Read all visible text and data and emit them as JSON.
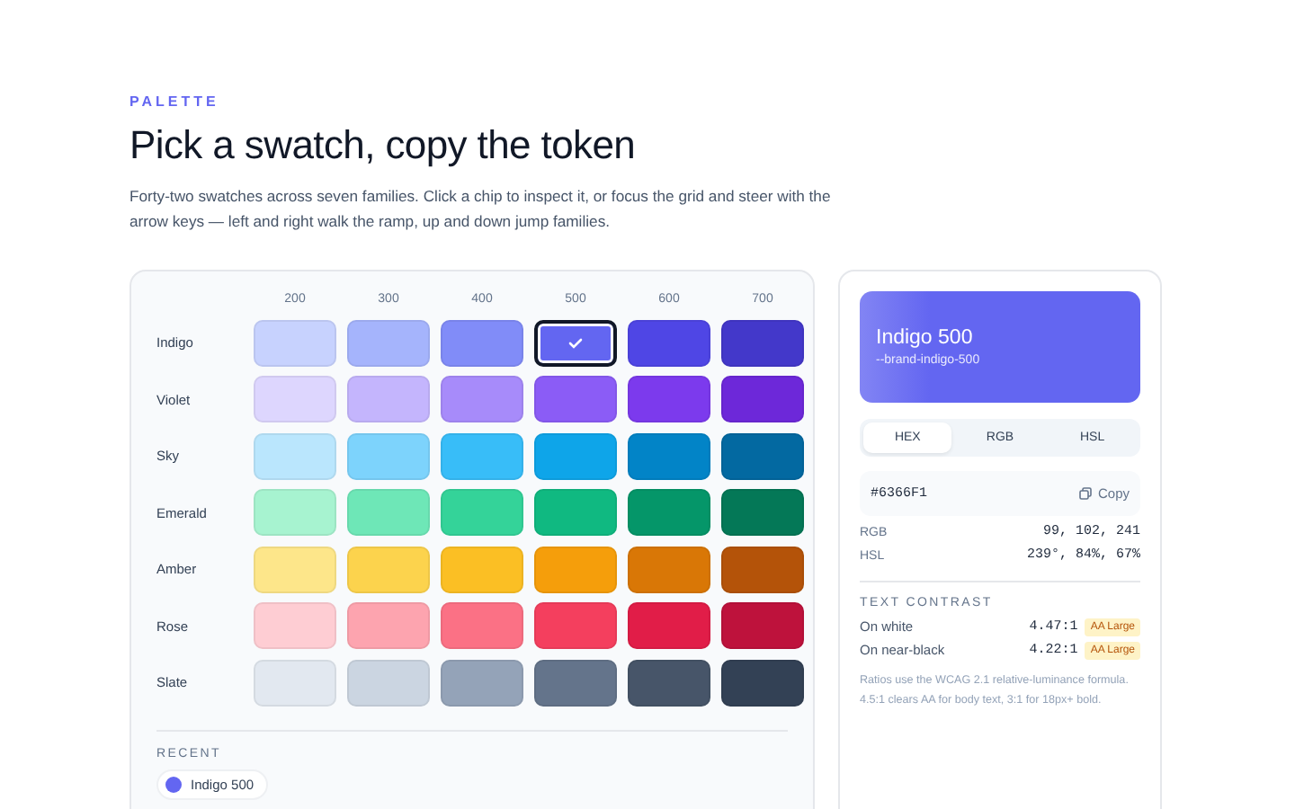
{
  "header": {
    "eyebrow": "PALETTE",
    "title": "Pick a swatch, copy the token",
    "description": "Forty-two swatches across seven families. Click a chip to inspect it, or focus the grid and steer with the arrow keys — left and right walk the ramp, up and down jump families."
  },
  "grid": {
    "columns": [
      "200",
      "300",
      "400",
      "500",
      "600",
      "700"
    ],
    "families": [
      {
        "name": "Indigo",
        "swatches": [
          {
            "color": "#c7d2fe",
            "selected": false
          },
          {
            "color": "#a5b4fc",
            "selected": false
          },
          {
            "color": "#818cf8",
            "selected": false
          },
          {
            "color": "#6366f1",
            "selected": true
          },
          {
            "color": "#4f46e5",
            "selected": false
          },
          {
            "color": "#4338ca",
            "selected": false
          }
        ]
      },
      {
        "name": "Violet",
        "swatches": [
          {
            "color": "#ddd6fe",
            "selected": false
          },
          {
            "color": "#c4b5fd",
            "selected": false
          },
          {
            "color": "#a78bfa",
            "selected": false
          },
          {
            "color": "#8b5cf6",
            "selected": false
          },
          {
            "color": "#7c3aed",
            "selected": false
          },
          {
            "color": "#6d28d9",
            "selected": false
          }
        ]
      },
      {
        "name": "Sky",
        "swatches": [
          {
            "color": "#bae6fd",
            "selected": false
          },
          {
            "color": "#7dd3fc",
            "selected": false
          },
          {
            "color": "#38bdf8",
            "selected": false
          },
          {
            "color": "#0ea5e9",
            "selected": false
          },
          {
            "color": "#0284c7",
            "selected": false
          },
          {
            "color": "#0369a1",
            "selected": false
          }
        ]
      },
      {
        "name": "Emerald",
        "swatches": [
          {
            "color": "#a7f3d0",
            "selected": false
          },
          {
            "color": "#6ee7b7",
            "selected": false
          },
          {
            "color": "#34d399",
            "selected": false
          },
          {
            "color": "#10b981",
            "selected": false
          },
          {
            "color": "#059669",
            "selected": false
          },
          {
            "color": "#047857",
            "selected": false
          }
        ]
      },
      {
        "name": "Amber",
        "swatches": [
          {
            "color": "#fde68a",
            "selected": false
          },
          {
            "color": "#fcd34d",
            "selected": false
          },
          {
            "color": "#fbbf24",
            "selected": false
          },
          {
            "color": "#f59e0b",
            "selected": false
          },
          {
            "color": "#d97706",
            "selected": false
          },
          {
            "color": "#b45309",
            "selected": false
          }
        ]
      },
      {
        "name": "Rose",
        "swatches": [
          {
            "color": "#fecdd3",
            "selected": false
          },
          {
            "color": "#fda4af",
            "selected": false
          },
          {
            "color": "#fb7185",
            "selected": false
          },
          {
            "color": "#f43f5e",
            "selected": false
          },
          {
            "color": "#e11d48",
            "selected": false
          },
          {
            "color": "#be123c",
            "selected": false
          }
        ]
      },
      {
        "name": "Slate",
        "swatches": [
          {
            "color": "#e2e8f0",
            "selected": false
          },
          {
            "color": "#cbd5e1",
            "selected": false
          },
          {
            "color": "#94a3b8",
            "selected": false
          },
          {
            "color": "#64748b",
            "selected": false
          },
          {
            "color": "#475569",
            "selected": false
          },
          {
            "color": "#334155",
            "selected": false
          }
        ]
      }
    ]
  },
  "recent": {
    "label": "RECENT",
    "items": [
      {
        "label": "Indigo 500",
        "color": "#6366f1"
      }
    ]
  },
  "inspector": {
    "name": "Indigo 500",
    "token": "--brand-indigo-500",
    "color": "#6366f1",
    "tabs": [
      {
        "label": "HEX",
        "selected": true
      },
      {
        "label": "RGB",
        "selected": false
      },
      {
        "label": "HSL",
        "selected": false
      }
    ],
    "value": "#6366F1",
    "copy": "Copy",
    "details": [
      {
        "label": "RGB",
        "value": "99, 102, 241"
      },
      {
        "label": "HSL",
        "value": "239°, 84%, 67%"
      }
    ],
    "contrast": {
      "title": "TEXT CONTRAST",
      "rows": [
        {
          "label": "On white",
          "ratio": "4.47:1",
          "badge": "AA Large"
        },
        {
          "label": "On near-black",
          "ratio": "4.22:1",
          "badge": "AA Large"
        }
      ],
      "note": "Ratios use the WCAG 2.1 relative-luminance formula. 4.5:1 clears AA for body text, 3:1 for 18px+ bold."
    }
  }
}
